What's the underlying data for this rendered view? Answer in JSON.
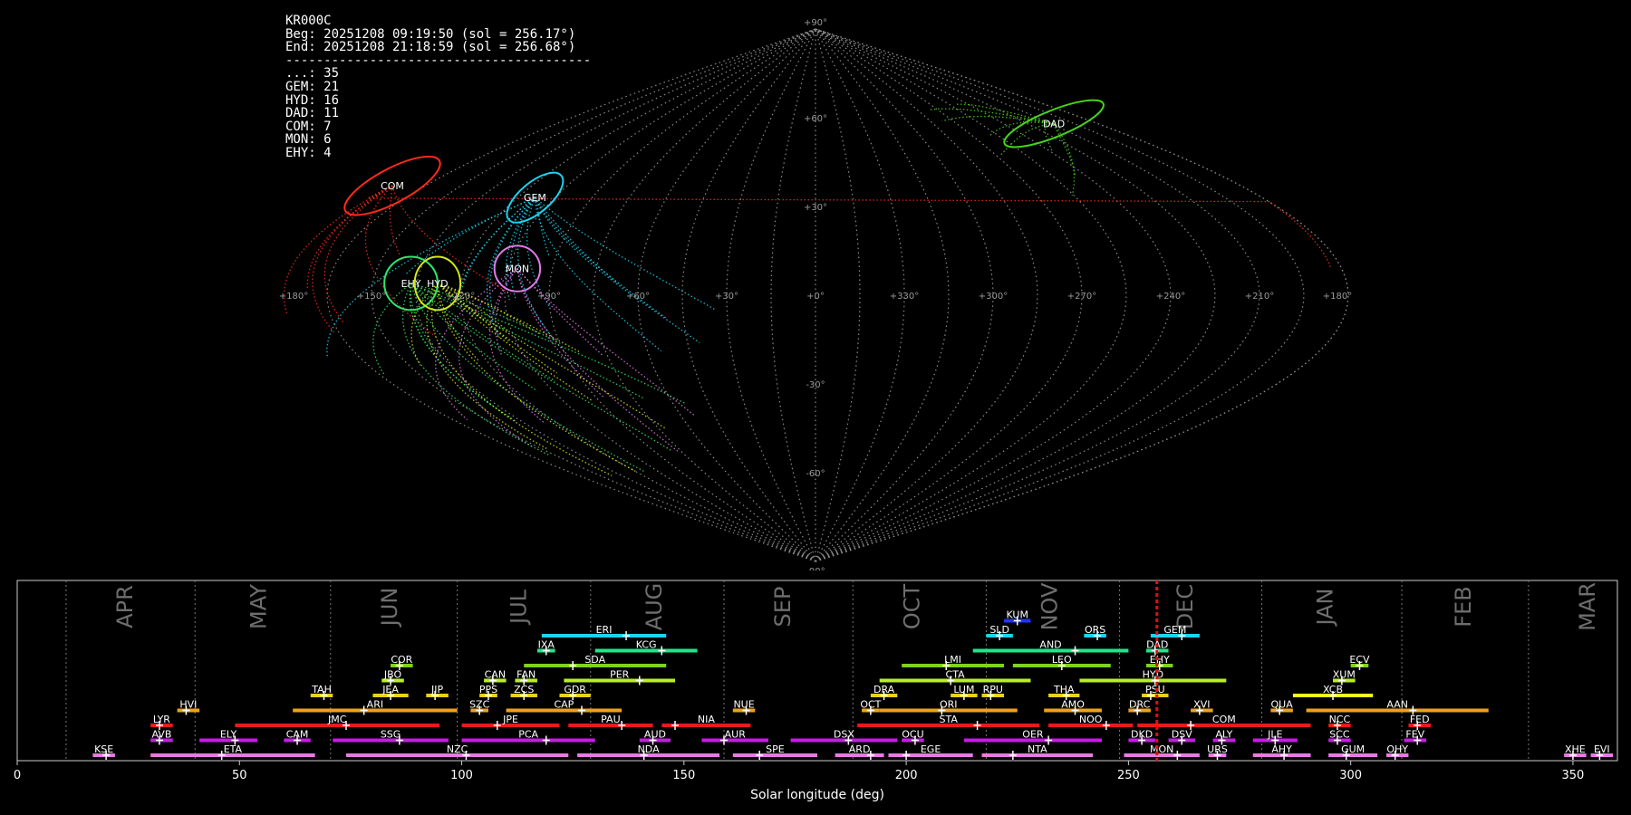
{
  "station": {
    "code": "KR000C",
    "begin": "Beg: 20251208 09:19:50 (sol = 256.17°)",
    "end": "End: 20251208 21:18:59 (sol = 256.68°)",
    "separator": "----------------------------------------",
    "counts": [
      {
        "label": "...: 35"
      },
      {
        "label": "GEM: 21"
      },
      {
        "label": "HYD: 16"
      },
      {
        "label": "DAD: 11"
      },
      {
        "label": "COM: 7"
      },
      {
        "label": "MON: 6"
      },
      {
        "label": "EHY: 4"
      }
    ]
  },
  "chart_data": [
    {
      "type": "scatter",
      "title": "",
      "projection": "sinusoidal",
      "lon_ticks": [
        "+180°",
        "+150°",
        "+120°",
        "+90°",
        "+60°",
        "+30°",
        "+0°",
        "+330°",
        "+300°",
        "+270°",
        "+240°",
        "+210°",
        "+180°"
      ],
      "lat_ticks": [
        "+90°",
        "+60°",
        "+30°",
        "-30°",
        "-60°",
        "-90°"
      ],
      "showers": [
        {
          "name": "COM",
          "ra": 179,
          "dec": 37,
          "color": "#ff2a1a",
          "rx": 14,
          "ry": 4.5,
          "rot": -28
        },
        {
          "name": "GEM",
          "ra": 113,
          "dec": 33,
          "color": "#1ad4f0",
          "rx": 9,
          "ry": 4,
          "rot": -40
        },
        {
          "name": "DAD",
          "ra": 208,
          "dec": 58,
          "color": "#46d418",
          "rx": 14,
          "ry": 3.5,
          "rot": -22
        },
        {
          "name": "MON",
          "ra": 102,
          "dec": 9,
          "color": "#e07ae8",
          "rx": 6,
          "ry": 6,
          "rot": 0
        },
        {
          "name": "EHY",
          "ra": 137,
          "dec": 4,
          "color": "#2ee66a",
          "rx": 7,
          "ry": 7,
          "rot": 0
        },
        {
          "name": "HYD",
          "ra": 128,
          "dec": 4,
          "color": "#d6e81a",
          "rx": 6,
          "ry": 7,
          "rot": 0
        }
      ]
    },
    {
      "type": "bar",
      "xlabel": "Solar longitude (deg)",
      "xlim": [
        0,
        360
      ],
      "x_ticks": [
        0,
        50,
        100,
        150,
        200,
        250,
        300,
        350
      ],
      "current_sol": 256.4,
      "months": [
        {
          "label": "APR",
          "start": 11,
          "center": 24.5
        },
        {
          "label": "MAY",
          "start": 40,
          "center": 54.5
        },
        {
          "label": "JUN",
          "start": 70.5,
          "center": 84
        },
        {
          "label": "JUL",
          "start": 99,
          "center": 113
        },
        {
          "label": "AUG",
          "start": 129,
          "center": 143.5
        },
        {
          "label": "SEP",
          "start": 159,
          "center": 172.5
        },
        {
          "label": "OCT",
          "start": 188,
          "center": 201.5
        },
        {
          "label": "NOV",
          "start": 218,
          "center": 232.5
        },
        {
          "label": "DEC",
          "start": 248,
          "center": 263
        },
        {
          "label": "JAN",
          "start": 280,
          "center": 294.5
        },
        {
          "label": "FEB",
          "start": 311.5,
          "center": 325.5
        },
        {
          "label": "MAR",
          "start": 340,
          "center": 353.5
        }
      ],
      "showers": [
        {
          "name": "KUM",
          "start": 222,
          "end": 228,
          "peak": 225,
          "row": 10,
          "color": "#2233ff"
        },
        {
          "name": "ERI",
          "start": 118,
          "end": 146,
          "peak": 137,
          "row": 9,
          "color": "#1ad4f0"
        },
        {
          "name": "SLD",
          "start": 218,
          "end": 224,
          "peak": 221,
          "row": 9,
          "color": "#1ad4f0"
        },
        {
          "name": "ORS",
          "start": 240,
          "end": 245,
          "peak": 243,
          "row": 9,
          "color": "#1ad4f0"
        },
        {
          "name": "GEM",
          "start": 255,
          "end": 266,
          "peak": 262,
          "row": 9,
          "color": "#1ad4f0"
        },
        {
          "name": "IXA",
          "start": 117,
          "end": 121,
          "peak": 119,
          "row": 8,
          "color": "#1fe68a"
        },
        {
          "name": "KCG",
          "start": 130,
          "end": 153,
          "peak": 145,
          "row": 8,
          "color": "#1fe68a"
        },
        {
          "name": "AND",
          "start": 215,
          "end": 250,
          "peak": 238,
          "row": 8,
          "color": "#1fe68a"
        },
        {
          "name": "DAD",
          "start": 254,
          "end": 259,
          "peak": 256,
          "row": 8,
          "color": "#1fe68a"
        },
        {
          "name": "COR",
          "start": 84,
          "end": 89,
          "peak": 86,
          "row": 7,
          "color": "#7ed41a"
        },
        {
          "name": "SDA",
          "start": 114,
          "end": 146,
          "peak": 125,
          "row": 7,
          "color": "#7ed41a"
        },
        {
          "name": "LMI",
          "start": 199,
          "end": 222,
          "peak": 209,
          "row": 7,
          "color": "#7ed41a"
        },
        {
          "name": "LEO",
          "start": 224,
          "end": 246,
          "peak": 235,
          "row": 7,
          "color": "#7ed41a"
        },
        {
          "name": "EHY",
          "start": 254,
          "end": 260,
          "peak": 257,
          "row": 7,
          "color": "#7ed41a"
        },
        {
          "name": "ECV",
          "start": 300,
          "end": 304,
          "peak": 302,
          "row": 7,
          "color": "#7ed41a"
        },
        {
          "name": "JBO",
          "start": 82,
          "end": 87,
          "peak": 84,
          "row": 6,
          "color": "#b8f020"
        },
        {
          "name": "CAN",
          "start": 105,
          "end": 110,
          "peak": 107,
          "row": 6,
          "color": "#b8f020"
        },
        {
          "name": "FAN",
          "start": 112,
          "end": 117,
          "peak": 114,
          "row": 6,
          "color": "#b8f020"
        },
        {
          "name": "PER",
          "start": 123,
          "end": 148,
          "peak": 140,
          "row": 6,
          "color": "#b8f020"
        },
        {
          "name": "CTA",
          "start": 194,
          "end": 228,
          "peak": 210,
          "row": 6,
          "color": "#b8f020"
        },
        {
          "name": "HYD",
          "start": 239,
          "end": 272,
          "peak": 256,
          "row": 6,
          "color": "#b8f020"
        },
        {
          "name": "XUM",
          "start": 296,
          "end": 301,
          "peak": 298,
          "row": 6,
          "color": "#b8f020"
        },
        {
          "name": "TAH",
          "start": 66,
          "end": 71,
          "peak": 69,
          "row": 5,
          "color": "#f0d018"
        },
        {
          "name": "JEA",
          "start": 80,
          "end": 88,
          "peak": 84,
          "row": 5,
          "color": "#f0d018"
        },
        {
          "name": "JIP",
          "start": 92,
          "end": 97,
          "peak": 94,
          "row": 5,
          "color": "#f0d018"
        },
        {
          "name": "PPS",
          "start": 104,
          "end": 108,
          "peak": 106,
          "row": 5,
          "color": "#f0d018"
        },
        {
          "name": "ZCS",
          "start": 111,
          "end": 117,
          "peak": 114,
          "row": 5,
          "color": "#f0d018"
        },
        {
          "name": "GDR",
          "start": 122,
          "end": 129,
          "peak": 125,
          "row": 5,
          "color": "#f0d018"
        },
        {
          "name": "DRA",
          "start": 192,
          "end": 198,
          "peak": 195,
          "row": 5,
          "color": "#f0d018"
        },
        {
          "name": "LUM",
          "start": 210,
          "end": 216,
          "peak": 213,
          "row": 5,
          "color": "#f0d018"
        },
        {
          "name": "RPU",
          "start": 217,
          "end": 222,
          "peak": 219,
          "row": 5,
          "color": "#f0d018"
        },
        {
          "name": "THA",
          "start": 232,
          "end": 239,
          "peak": 236,
          "row": 5,
          "color": "#f0d018"
        },
        {
          "name": "PSU",
          "start": 253,
          "end": 259,
          "peak": 255,
          "row": 5,
          "color": "#f0d018"
        },
        {
          "name": "XCB",
          "start": 287,
          "end": 305,
          "peak": 296,
          "row": 5,
          "color": "#ffff1a"
        },
        {
          "name": "HVI",
          "start": 36,
          "end": 41,
          "peak": 38,
          "row": 4,
          "color": "#f0a018"
        },
        {
          "name": "ARI",
          "start": 62,
          "end": 99,
          "peak": 78,
          "row": 4,
          "color": "#f0a018"
        },
        {
          "name": "SZC",
          "start": 102,
          "end": 106,
          "peak": 104,
          "row": 4,
          "color": "#f0a018"
        },
        {
          "name": "CAP",
          "start": 110,
          "end": 136,
          "peak": 127,
          "row": 4,
          "color": "#f0a018"
        },
        {
          "name": "NUE",
          "start": 161,
          "end": 166,
          "peak": 164,
          "row": 4,
          "color": "#f0a018"
        },
        {
          "name": "OCT",
          "start": 190,
          "end": 194,
          "peak": 192,
          "row": 4,
          "color": "#f0a018"
        },
        {
          "name": "ORI",
          "start": 194,
          "end": 225,
          "peak": 208,
          "row": 4,
          "color": "#f0a018"
        },
        {
          "name": "AMO",
          "start": 231,
          "end": 244,
          "peak": 238,
          "row": 4,
          "color": "#f0a018"
        },
        {
          "name": "DRC",
          "start": 250,
          "end": 255,
          "peak": 252,
          "row": 4,
          "color": "#f0a018"
        },
        {
          "name": "XVI",
          "start": 264,
          "end": 269,
          "peak": 266,
          "row": 4,
          "color": "#f0a018"
        },
        {
          "name": "QUA",
          "start": 282,
          "end": 287,
          "peak": 284,
          "row": 4,
          "color": "#f0a018"
        },
        {
          "name": "AAN",
          "start": 290,
          "end": 331,
          "peak": 314,
          "row": 4,
          "color": "#f0a018"
        },
        {
          "name": "LYR",
          "start": 30,
          "end": 35,
          "peak": 32,
          "row": 3,
          "color": "#e81a1a"
        },
        {
          "name": "JMC",
          "start": 49,
          "end": 95,
          "peak": 74,
          "row": 3,
          "color": "#e81a1a"
        },
        {
          "name": "JPE",
          "start": 100,
          "end": 122,
          "peak": 108,
          "row": 3,
          "color": "#e81a1a"
        },
        {
          "name": "PAU",
          "start": 124,
          "end": 143,
          "peak": 136,
          "row": 3,
          "color": "#e81a1a"
        },
        {
          "name": "NIA",
          "start": 145,
          "end": 165,
          "peak": 148,
          "row": 3,
          "color": "#e81a1a"
        },
        {
          "name": "STA",
          "start": 189,
          "end": 230,
          "peak": 216,
          "row": 3,
          "color": "#e81a1a"
        },
        {
          "name": "NOO",
          "start": 232,
          "end": 251,
          "peak": 245,
          "row": 3,
          "color": "#e81a1a"
        },
        {
          "name": "COM",
          "start": 252,
          "end": 291,
          "peak": 264,
          "row": 3,
          "color": "#e81a1a"
        },
        {
          "name": "NCC",
          "start": 295,
          "end": 300,
          "peak": 297,
          "row": 3,
          "color": "#e81a1a"
        },
        {
          "name": "FED",
          "start": 313,
          "end": 318,
          "peak": 315,
          "row": 3,
          "color": "#e81a1a"
        },
        {
          "name": "AVB",
          "start": 30,
          "end": 35,
          "peak": 32,
          "row": 2,
          "color": "#c81ae8"
        },
        {
          "name": "ELY",
          "start": 41,
          "end": 54,
          "peak": 49,
          "row": 2,
          "color": "#c81ae8"
        },
        {
          "name": "CAM",
          "start": 60,
          "end": 66,
          "peak": 63,
          "row": 2,
          "color": "#c81ae8"
        },
        {
          "name": "SSG",
          "start": 71,
          "end": 97,
          "peak": 86,
          "row": 2,
          "color": "#c81ae8"
        },
        {
          "name": "PCA",
          "start": 100,
          "end": 130,
          "peak": 119,
          "row": 2,
          "color": "#c81ae8"
        },
        {
          "name": "AUD",
          "start": 140,
          "end": 147,
          "peak": 143,
          "row": 2,
          "color": "#c81ae8"
        },
        {
          "name": "AUR",
          "start": 154,
          "end": 169,
          "peak": 159,
          "row": 2,
          "color": "#c81ae8"
        },
        {
          "name": "DSX",
          "start": 174,
          "end": 198,
          "peak": 187,
          "row": 2,
          "color": "#c81ae8"
        },
        {
          "name": "OCU",
          "start": 199,
          "end": 204,
          "peak": 202,
          "row": 2,
          "color": "#c81ae8"
        },
        {
          "name": "OER",
          "start": 213,
          "end": 244,
          "peak": 232,
          "row": 2,
          "color": "#c81ae8"
        },
        {
          "name": "DKD",
          "start": 250,
          "end": 256,
          "peak": 253,
          "row": 2,
          "color": "#c81ae8"
        },
        {
          "name": "DSV",
          "start": 259,
          "end": 265,
          "peak": 262,
          "row": 2,
          "color": "#c81ae8"
        },
        {
          "name": "ALY",
          "start": 269,
          "end": 274,
          "peak": 271,
          "row": 2,
          "color": "#c81ae8"
        },
        {
          "name": "JLE",
          "start": 278,
          "end": 288,
          "peak": 283,
          "row": 2,
          "color": "#c81ae8"
        },
        {
          "name": "SCC",
          "start": 295,
          "end": 300,
          "peak": 297,
          "row": 2,
          "color": "#c81ae8"
        },
        {
          "name": "FEV",
          "start": 312,
          "end": 317,
          "peak": 315,
          "row": 2,
          "color": "#c81ae8"
        },
        {
          "name": "KSE",
          "start": 17,
          "end": 22,
          "peak": 20,
          "row": 1,
          "color": "#e87ae0"
        },
        {
          "name": "ETA",
          "start": 30,
          "end": 67,
          "peak": 46,
          "row": 1,
          "color": "#e87ae0"
        },
        {
          "name": "NZC",
          "start": 74,
          "end": 124,
          "peak": 101,
          "row": 1,
          "color": "#e87ae0"
        },
        {
          "name": "NDA",
          "start": 126,
          "end": 158,
          "peak": 141,
          "row": 1,
          "color": "#e87ae0"
        },
        {
          "name": "SPE",
          "start": 161,
          "end": 180,
          "peak": 167,
          "row": 1,
          "color": "#e87ae0"
        },
        {
          "name": "ARD",
          "start": 184,
          "end": 195,
          "peak": 192,
          "row": 1,
          "color": "#e87ae0"
        },
        {
          "name": "EGE",
          "start": 196,
          "end": 215,
          "peak": 200,
          "row": 1,
          "color": "#e87ae0"
        },
        {
          "name": "NTA",
          "start": 217,
          "end": 242,
          "peak": 224,
          "row": 1,
          "color": "#e87ae0"
        },
        {
          "name": "MON",
          "start": 249,
          "end": 266,
          "peak": 261,
          "row": 1,
          "color": "#e87ae0"
        },
        {
          "name": "URS",
          "start": 268,
          "end": 272,
          "peak": 270,
          "row": 1,
          "color": "#e87ae0"
        },
        {
          "name": "AHY",
          "start": 278,
          "end": 291,
          "peak": 285,
          "row": 1,
          "color": "#e87ae0"
        },
        {
          "name": "GUM",
          "start": 295,
          "end": 306,
          "peak": 299,
          "row": 1,
          "color": "#e87ae0"
        },
        {
          "name": "OHY",
          "start": 308,
          "end": 313,
          "peak": 310,
          "row": 1,
          "color": "#e87ae0"
        },
        {
          "name": "XHE",
          "start": 348,
          "end": 353,
          "peak": 350,
          "row": 1,
          "color": "#e87ae0"
        },
        {
          "name": "EVI",
          "start": 354,
          "end": 359,
          "peak": 356,
          "row": 1,
          "color": "#e87ae0"
        }
      ]
    }
  ]
}
